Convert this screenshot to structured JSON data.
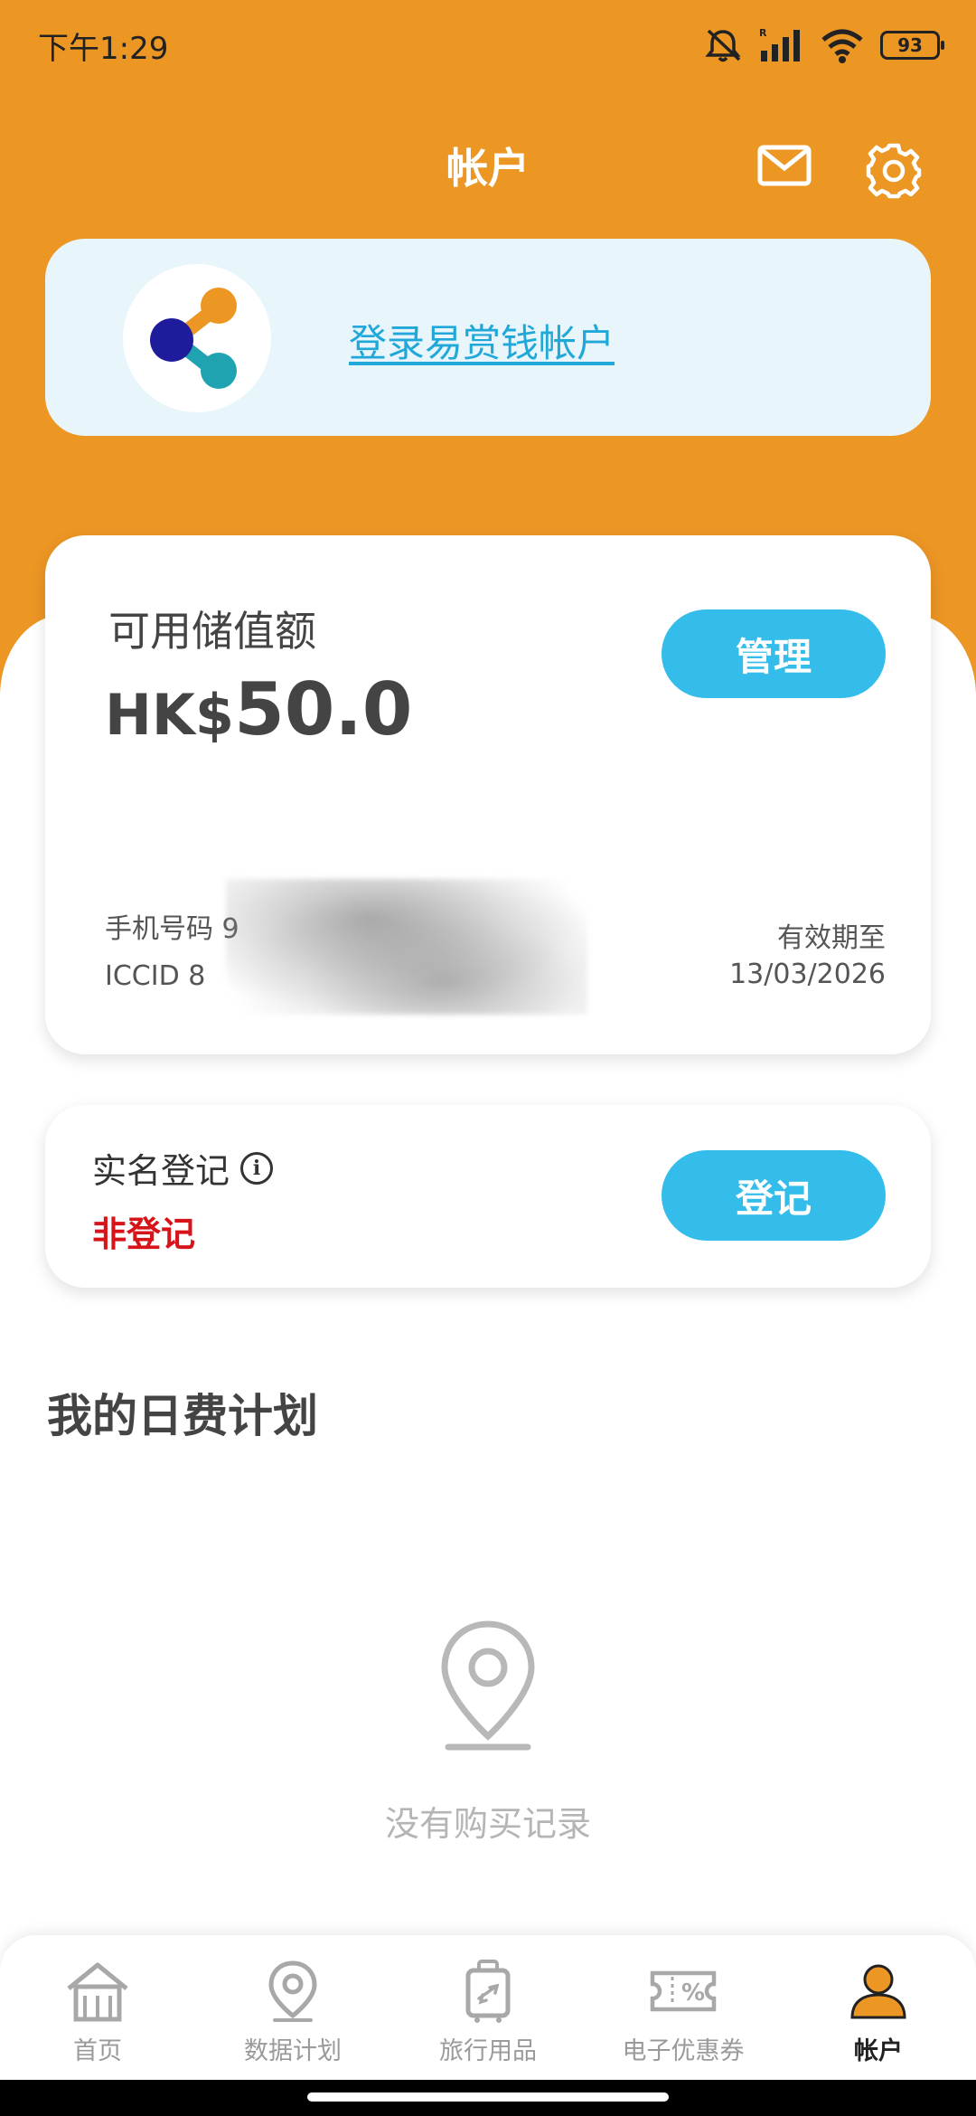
{
  "status_bar": {
    "time": "下午1:29",
    "battery": "93",
    "icons": [
      "mute-icon",
      "signal-icon",
      "wifi-icon",
      "battery-icon"
    ]
  },
  "header": {
    "title": "帐户",
    "icons": [
      "mail-icon",
      "gear-icon"
    ]
  },
  "wallet": {
    "login_link": "登录易赏钱帐户",
    "logo": "wallet-logo-icon"
  },
  "balance": {
    "label": "可用储值额",
    "currency": "HK$",
    "amount": "50.0",
    "manage_label": "管理",
    "phone_label": "手机号码 9",
    "iccid_label": "ICCID 8",
    "expiry_label": "有效期至",
    "expiry_date": "13/03/2026"
  },
  "registration": {
    "label": "实名登记",
    "status": "非登记",
    "button_label": "登记",
    "colors": {
      "status": "#D8141B",
      "button": "#34BDEA"
    }
  },
  "plans": {
    "section_title": "我的日费计划",
    "empty_text": "没有购买记录",
    "empty_icon": "location-pin-icon"
  },
  "nav": {
    "items": [
      {
        "label": "首页",
        "icon": "home-icon",
        "active": false
      },
      {
        "label": "数据计划",
        "icon": "location-pin-icon",
        "active": false
      },
      {
        "label": "旅行用品",
        "icon": "luggage-icon",
        "active": false
      },
      {
        "label": "电子优惠券",
        "icon": "coupon-icon",
        "active": false
      },
      {
        "label": "帐户",
        "icon": "user-icon",
        "active": true
      }
    ]
  },
  "theme": {
    "primary": "#EC9624",
    "accent": "#34BDEA"
  }
}
